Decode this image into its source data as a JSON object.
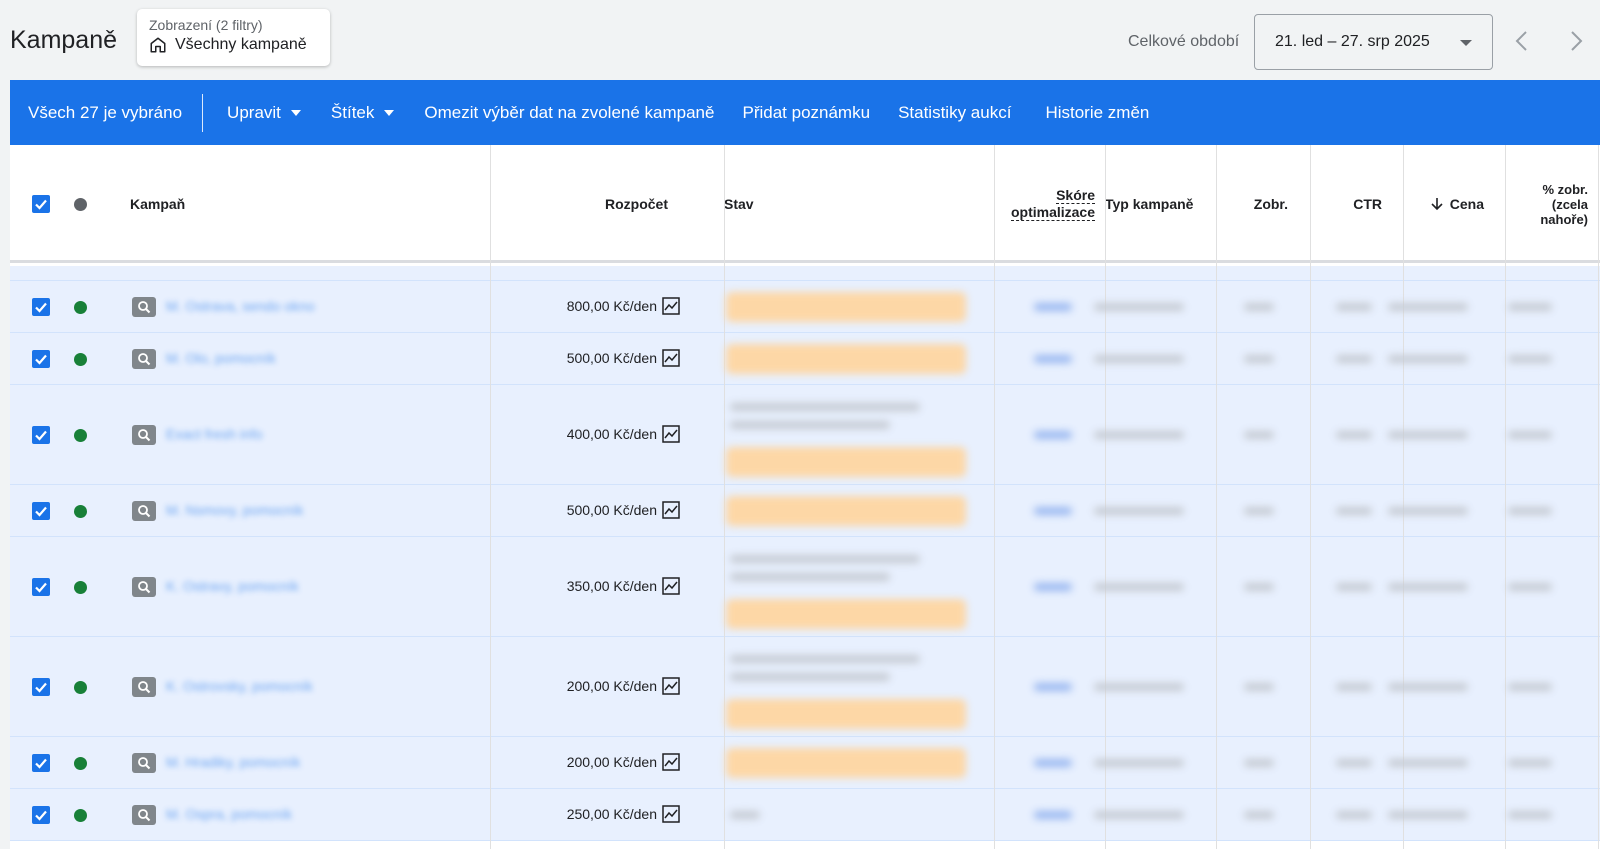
{
  "header": {
    "title": "Kampaně",
    "view_label": "Zobrazení (2 filtry)",
    "view_value": "Všechny kampaně",
    "period_label": "Celkové období",
    "date_range": "21. led – 27. srp 2025"
  },
  "action_bar": {
    "selected": "Všech 27 je vybráno",
    "edit": "Upravit",
    "label": "Štítek",
    "limit": "Omezit výběr dat na zvolené kampaně",
    "add_note": "Přidat poznámku",
    "auction": "Statistiky aukcí",
    "history": "Historie změn"
  },
  "columns": {
    "campaign": "Kampaň",
    "budget": "Rozpočet",
    "status": "Stav",
    "opt_score_1": "Skóre",
    "opt_score_2": "optimalizace",
    "type": "Typ kampaně",
    "impr": "Zobr.",
    "ctr": "CTR",
    "cost": "Cena",
    "top_1": "% zobr.",
    "top_2": "(zcela",
    "top_3": "nahoře)"
  },
  "rows": [
    {
      "name": "M. Ostrava, sendo okno",
      "budget": "800,00 Kč/den"
    },
    {
      "name": "M. Olo, pomocník",
      "budget": "500,00 Kč/den"
    },
    {
      "name": "Exact fresh info",
      "budget": "400,00 Kč/den"
    },
    {
      "name": "M. Nsmovy, pomocník",
      "budget": "500,00 Kč/den"
    },
    {
      "name": "K. Ostravy, pomocník",
      "budget": "350,00 Kč/den"
    },
    {
      "name": "K. Ostrovsky, pomocník",
      "budget": "200,00 Kč/den"
    },
    {
      "name": "M. Hradiky, pomocník",
      "budget": "200,00 Kč/den"
    },
    {
      "name": "M. Ospra, pomocník",
      "budget": "250,00 Kč/den"
    }
  ],
  "colors": {
    "accent": "#1a73e8",
    "enabled": "#188038",
    "row_bg": "#e8f0fe"
  }
}
